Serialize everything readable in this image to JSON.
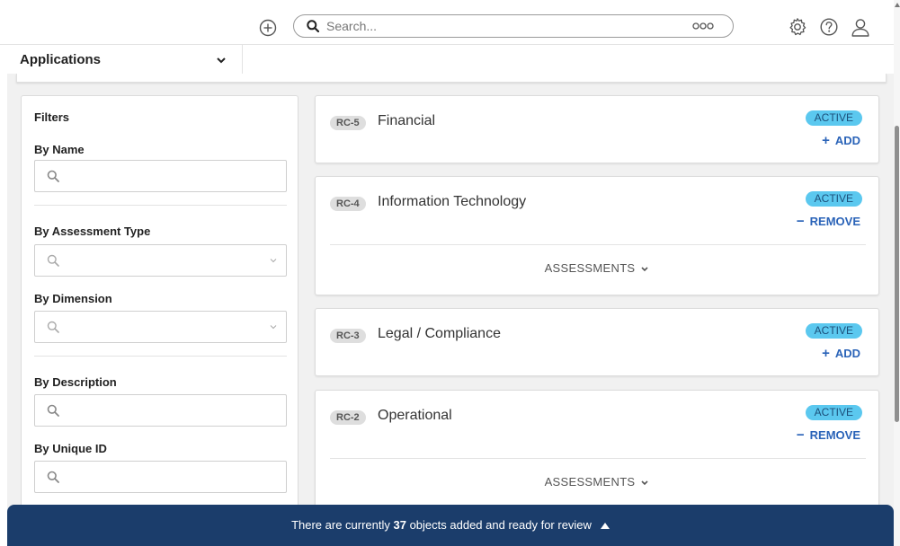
{
  "topbar": {
    "search_placeholder": "Search..."
  },
  "appbar": {
    "app_label": "Applications"
  },
  "filters": {
    "title": "Filters",
    "by_name": "By Name",
    "by_assessment_type": "By Assessment Type",
    "by_dimension": "By Dimension",
    "by_description": "By Description",
    "by_unique_id": "By Unique ID"
  },
  "cards": [
    {
      "id": "RC-5",
      "title": "Financial",
      "status": "ACTIVE",
      "action": "ADD",
      "action_symbol": "+"
    },
    {
      "id": "RC-4",
      "title": "Information Technology",
      "status": "ACTIVE",
      "action": "REMOVE",
      "action_symbol": "−",
      "assessments_label": "ASSESSMENTS"
    },
    {
      "id": "RC-3",
      "title": "Legal / Compliance",
      "status": "ACTIVE",
      "action": "ADD",
      "action_symbol": "+"
    },
    {
      "id": "RC-2",
      "title": "Operational",
      "status": "ACTIVE",
      "action": "REMOVE",
      "action_symbol": "−",
      "assessments_label": "ASSESSMENTS"
    }
  ],
  "review_bar": {
    "text_before": "There are currently ",
    "count": "37",
    "text_after": " objects added and ready for review"
  },
  "colors": {
    "accent_blue": "#2a63b8",
    "status_active_bg": "#5bc8ef",
    "review_bar_bg": "#1b3d6b"
  }
}
